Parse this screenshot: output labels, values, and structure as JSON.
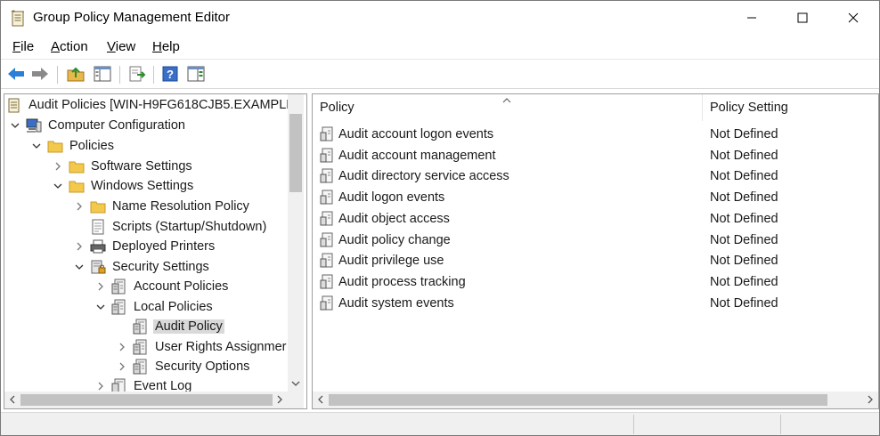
{
  "window": {
    "title": "Group Policy Management Editor",
    "app_icon": "policy-document-icon"
  },
  "menu": [
    {
      "label": "File",
      "accel": "F",
      "rest": "ile"
    },
    {
      "label": "Action",
      "accel": "A",
      "rest": "ction"
    },
    {
      "label": "View",
      "accel": "V",
      "rest": "iew"
    },
    {
      "label": "Help",
      "accel": "H",
      "rest": "elp"
    }
  ],
  "toolbar": {
    "buttons": [
      "back-arrow-icon",
      "forward-arrow-icon",
      "up-folder-icon",
      "show-hide-tree-icon",
      "export-list-icon",
      "help-icon",
      "properties-pane-icon"
    ]
  },
  "tree": {
    "root": "Audit Policies [WIN-H9FG618CJB5.EXAMPLE",
    "items": [
      {
        "label": "Computer Configuration",
        "icon": "computer-icon"
      },
      {
        "label": "Policies",
        "icon": "folder-icon"
      },
      {
        "label": "Software Settings",
        "icon": "folder-icon"
      },
      {
        "label": "Windows Settings",
        "icon": "folder-icon"
      },
      {
        "label": "Name Resolution Policy",
        "icon": "folder-icon"
      },
      {
        "label": "Scripts (Startup/Shutdown)",
        "icon": "script-icon"
      },
      {
        "label": "Deployed Printers",
        "icon": "printer-icon"
      },
      {
        "label": "Security Settings",
        "icon": "security-icon"
      },
      {
        "label": "Account Policies",
        "icon": "policy-icon"
      },
      {
        "label": "Local Policies",
        "icon": "policy-icon"
      },
      {
        "label": "Audit Policy",
        "icon": "policy-icon"
      },
      {
        "label": "User Rights Assignmer",
        "icon": "policy-icon"
      },
      {
        "label": "Security Options",
        "icon": "policy-icon"
      },
      {
        "label": "Event Log",
        "icon": "policy-icon"
      }
    ]
  },
  "list": {
    "columns": {
      "policy": "Policy",
      "setting": "Policy Setting"
    },
    "rows": [
      {
        "policy": "Audit account logon events",
        "setting": "Not Defined"
      },
      {
        "policy": "Audit account management",
        "setting": "Not Defined"
      },
      {
        "policy": "Audit directory service access",
        "setting": "Not Defined"
      },
      {
        "policy": "Audit logon events",
        "setting": "Not Defined"
      },
      {
        "policy": "Audit object access",
        "setting": "Not Defined"
      },
      {
        "policy": "Audit policy change",
        "setting": "Not Defined"
      },
      {
        "policy": "Audit privilege use",
        "setting": "Not Defined"
      },
      {
        "policy": "Audit process tracking",
        "setting": "Not Defined"
      },
      {
        "policy": "Audit system events",
        "setting": "Not Defined"
      }
    ]
  },
  "colors": {
    "selection": "#d9d9d9",
    "scrollbar_thumb": "#c2c2c2",
    "nav_arrow": "#2b7fd4",
    "folder": "#f2c94c"
  }
}
